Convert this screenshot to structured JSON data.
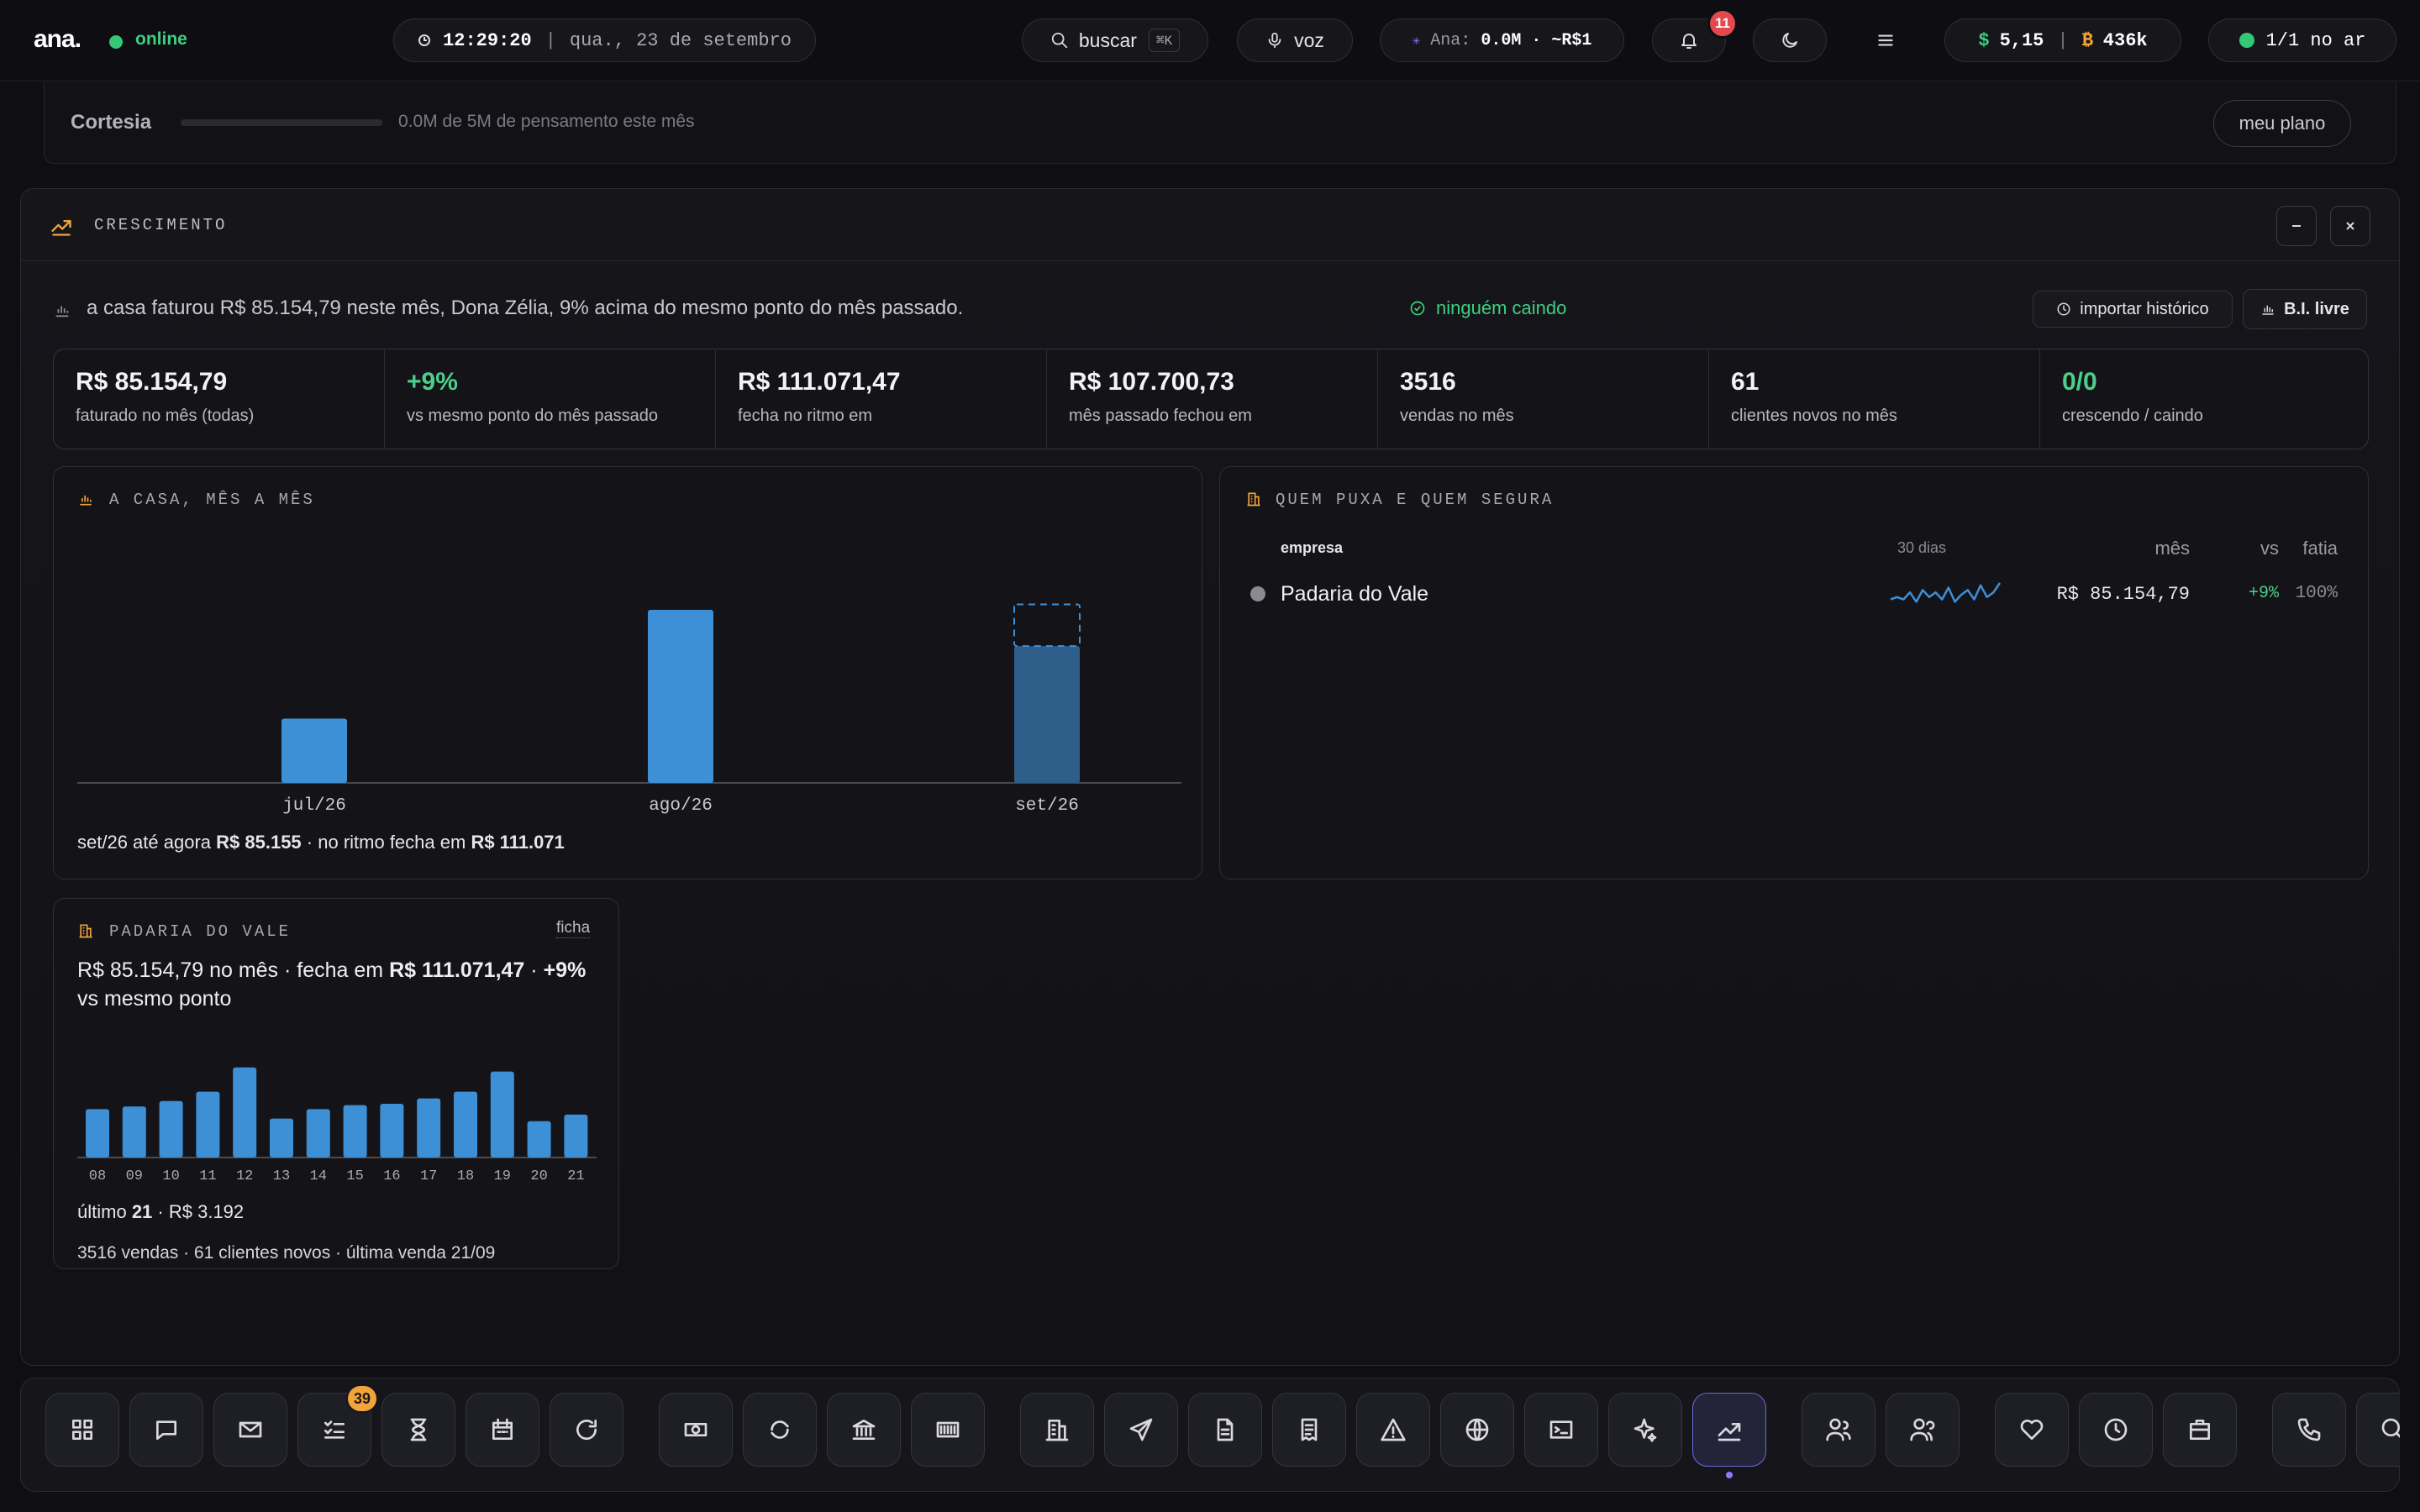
{
  "topbar": {
    "logo": "ana.",
    "status": "online",
    "clock": {
      "time": "12:29:20",
      "sep": "|",
      "date": "qua., 23 de setembro"
    },
    "search": {
      "label": "buscar",
      "shortcut": "⌘K"
    },
    "voice": {
      "label": "voz"
    },
    "ana_usage": {
      "prefix": "Ana:",
      "value": "0.0M · ~R$1"
    },
    "notifications": {
      "count": "11"
    },
    "wallet": {
      "usd_symbol": "$",
      "usd": "5,15",
      "sep": "|",
      "btc_symbol": "₿",
      "btc": "436k"
    },
    "live": {
      "label": "1/1 no ar"
    }
  },
  "plan": {
    "name": "Cortesia",
    "usage_text": "0.0M de 5M de pensamento este mês",
    "usage_fraction": 0.0,
    "button": "meu plano"
  },
  "panel": {
    "title": "CRESCIMENTO",
    "summary": "a casa faturou R$ 85.154,79 neste mês, Dona Zélia, 9% acima do mesmo ponto do mês passado.",
    "health": "ninguém caindo",
    "import_button": "importar histórico",
    "bi_button": "B.I. livre",
    "kpis": [
      {
        "value": "R$ 85.154,79",
        "label": "faturado no mês (todas)",
        "color": "#f3f3f6"
      },
      {
        "value": "+9%",
        "label": "vs mesmo ponto do mês passado",
        "color": "#4ccf8a"
      },
      {
        "value": "R$ 111.071,47",
        "label": "fecha no ritmo em",
        "color": "#f3f3f6"
      },
      {
        "value": "R$ 107.700,73",
        "label": "mês passado fechou em",
        "color": "#f3f3f6"
      },
      {
        "value": "3516",
        "label": "vendas no mês",
        "color": "#f3f3f6"
      },
      {
        "value": "61",
        "label": "clientes novos no mês",
        "color": "#f3f3f6"
      },
      {
        "value": "0/0",
        "label": "crescendo / caindo",
        "color": "#4ccf8a"
      }
    ]
  },
  "monthly": {
    "title": "A CASA, MÊS A MÊS",
    "footer_prefix": "set/26 até agora",
    "footer_now": "R$ 85.155",
    "footer_mid": "· no ritmo fecha em",
    "footer_proj": "R$ 111.071"
  },
  "ranking": {
    "title": "QUEM PUXA E QUEM SEGURA",
    "headers": {
      "company": "empresa",
      "spark": "30 dias",
      "month": "mês",
      "vs": "vs",
      "share": "fatia"
    },
    "rows": [
      {
        "name": "Padaria do Vale",
        "month": "R$ 85.154,79",
        "vs": "+9%",
        "share": "100%",
        "spark": [
          3,
          4,
          3,
          6,
          2,
          7,
          4,
          6,
          3,
          8,
          2,
          5,
          7,
          3,
          9,
          4,
          6,
          10
        ]
      }
    ]
  },
  "company_card": {
    "title": "PADARIA DO VALE",
    "link": "ficha",
    "line1_a": "R$ 85.154,79 no mês · fecha em",
    "line1_b": "R$ 111.071,47",
    "line1_c": "·",
    "line1_d": "+9%",
    "line2": "vs mesmo ponto",
    "last_prefix": "último",
    "last_day": "21",
    "last_value": "· R$ 3.192",
    "footer": "3516 vendas · 61 clientes novos · última venda 21/09"
  },
  "chart_data": [
    {
      "type": "bar",
      "categories": [
        "jul/26",
        "ago/26",
        "set/26"
      ],
      "series": [
        {
          "values": [
            40000,
            107700.73,
            85154.79
          ]
        }
      ],
      "projection": {
        "category": "set/26",
        "value": 111071.47
      },
      "ylim": [
        0,
        115000
      ],
      "grid": false
    },
    {
      "type": "bar",
      "categories": [
        "08",
        "09",
        "10",
        "11",
        "12",
        "13",
        "14",
        "15",
        "16",
        "17",
        "18",
        "19",
        "20",
        "21"
      ],
      "series": [
        {
          "values": [
            3600,
            3800,
            4200,
            4900,
            6700,
            2900,
            3600,
            3900,
            4000,
            4400,
            4900,
            6400,
            2700,
            3192
          ]
        }
      ],
      "ylim": [
        0,
        7000
      ],
      "grid": false
    }
  ],
  "dock": {
    "badge": "39",
    "icons": [
      "grid-icon",
      "chat-icon",
      "mail-icon",
      "tasks-icon",
      "hourglass-icon",
      "calendar-icon",
      "refresh-icon",
      "cash-icon",
      "sync-icon",
      "bank-icon",
      "barcode-icon",
      "building-icon",
      "send-icon",
      "document-icon",
      "receipt-icon",
      "alert-icon",
      "globe-icon",
      "terminal-icon",
      "sparkle-icon",
      "trending-icon",
      "user-group-icon",
      "users-icon",
      "heart-icon",
      "clock-icon",
      "briefcase-icon",
      "phone-icon",
      "search-icon"
    ]
  }
}
